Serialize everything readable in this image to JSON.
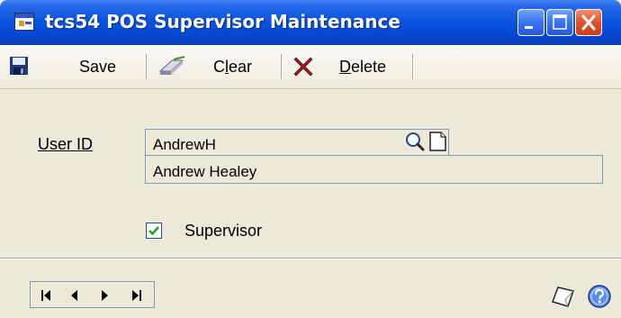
{
  "window": {
    "title": "tcs54 POS Supervisor Maintenance"
  },
  "titlebar_buttons": {
    "minimize": "minimize-icon",
    "maximize": "maximize-icon",
    "close": "close-icon"
  },
  "toolbar": {
    "save_label": "Save",
    "clear_label": "Clear",
    "delete_label": "Delete"
  },
  "form": {
    "user_id_label": "User ID",
    "user_id_value": "AndrewH",
    "user_name_value": "Andrew Healey",
    "supervisor_label": "Supervisor",
    "supervisor_checked": true
  },
  "navigation": {
    "first": "first-record-icon",
    "previous": "previous-record-icon",
    "next": "next-record-icon",
    "last": "last-record-icon"
  },
  "colors": {
    "titlebar": "#0a55e0",
    "window_bg": "#ece9d8",
    "field_border": "#7f9db9",
    "check_mark": "#21a121"
  }
}
